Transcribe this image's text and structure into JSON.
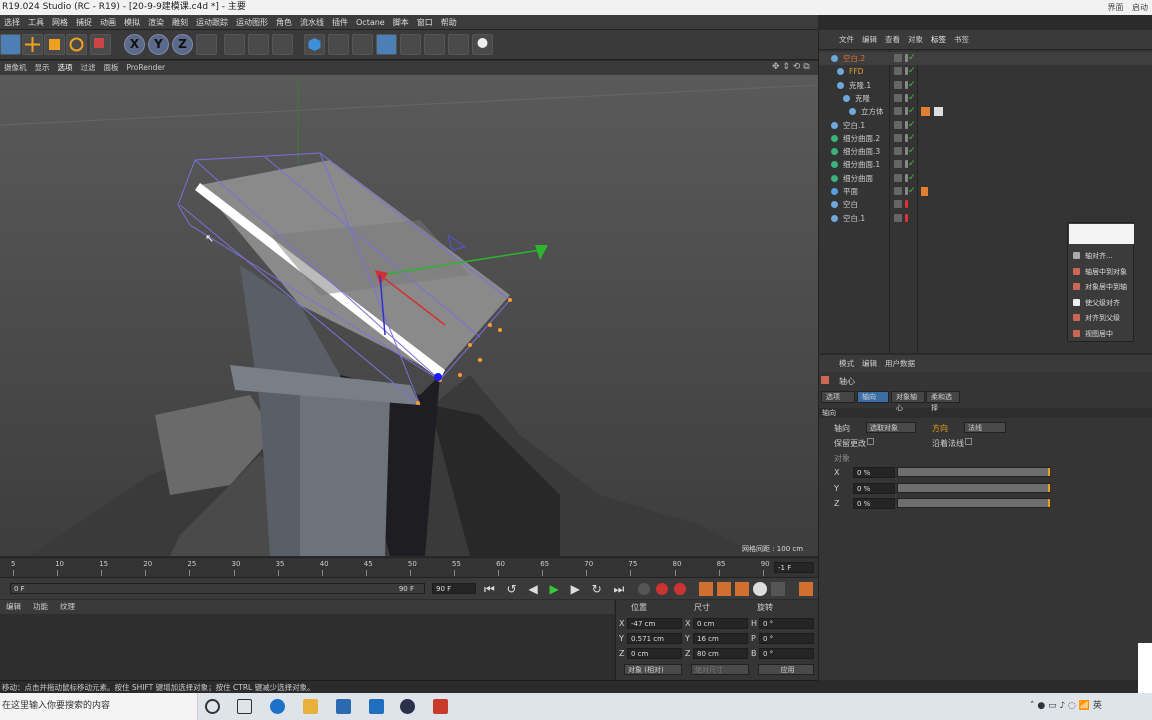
{
  "window": {
    "title": "R19.024 Studio (RC - R19) - [20-9-9建模课.c4d *] - 主要",
    "right_buttons": [
      "界面",
      "启动"
    ]
  },
  "menubar": [
    "选择",
    "工具",
    "网格",
    "捕捉",
    "动画",
    "模拟",
    "渲染",
    "雕刻",
    "运动跟踪",
    "运动图形",
    "角色",
    "流水线",
    "插件",
    "Octane",
    "脚本",
    "窗口",
    "帮助"
  ],
  "viewport": {
    "menu": [
      "摄像机",
      "显示",
      "选项",
      "过滤",
      "面板",
      "ProRender"
    ],
    "grid_spacing": "网格间距 : 100 cm"
  },
  "timeline": {
    "ticks": [
      "5",
      "10",
      "15",
      "20",
      "25",
      "30",
      "35",
      "40",
      "45",
      "50",
      "55",
      "60",
      "65",
      "70",
      "75",
      "80",
      "85",
      "90"
    ],
    "end_frame_field": "-1 F",
    "start_field": "0 F",
    "range_end": "90 F",
    "end_field": "90 F"
  },
  "material_tabs": [
    "编辑",
    "功能",
    "纹理"
  ],
  "coordinates": {
    "headers": [
      "位置",
      "尺寸",
      "旋转"
    ],
    "rows": [
      {
        "axis": "X",
        "pos": "-47 cm",
        "size_axis": "X",
        "size": "0 cm",
        "rot_axis": "H",
        "rot": "0 °"
      },
      {
        "axis": "Y",
        "pos": "0.571 cm",
        "size_axis": "Y",
        "size": "16 cm",
        "rot_axis": "P",
        "rot": "0 °"
      },
      {
        "axis": "Z",
        "pos": "0 cm",
        "size_axis": "Z",
        "size": "80 cm",
        "rot_axis": "B",
        "rot": "0 °"
      }
    ],
    "mode_select": "对象 (相对)",
    "size_select": "绝对尺寸",
    "apply_button": "应用"
  },
  "statusbar": "移动：点击并拖动鼠标移动元素。按住 SHIFT 键增加选择对象；按住 CTRL 键减少选择对象。",
  "object_manager": {
    "tabs": [
      "文件",
      "编辑",
      "查看",
      "对象",
      "标签",
      "书签"
    ],
    "objects": [
      {
        "name": "空白.2",
        "color": "#e07030"
      },
      {
        "name": "FFD",
        "color": "#e0a030"
      },
      {
        "name": "克隆.1",
        "color": "#cccccc"
      },
      {
        "name": "克隆",
        "color": "#cccccc"
      },
      {
        "name": "立方体",
        "color": "#cccccc"
      },
      {
        "name": "空白.1",
        "color": "#cccccc"
      },
      {
        "name": "细分曲面.2",
        "color": "#cccccc"
      },
      {
        "name": "细分曲面.3",
        "color": "#cccccc"
      },
      {
        "name": "细分曲面.1",
        "color": "#cccccc"
      },
      {
        "name": "细分曲面",
        "color": "#cccccc"
      },
      {
        "name": "平面",
        "color": "#cccccc"
      },
      {
        "name": "空白",
        "color": "#cccccc"
      },
      {
        "name": "空白.1",
        "color": "#cccccc"
      }
    ]
  },
  "context_menu": {
    "header": "轴对齐...",
    "items": [
      "轴居中到对象",
      "对象居中到轴",
      "使父级对齐",
      "对齐到父级",
      "视图居中"
    ]
  },
  "attribute_manager": {
    "tabs": [
      "模式",
      "编辑",
      "用户数据"
    ],
    "object_label": "轴心",
    "subtabs": [
      "选项",
      "轴向",
      "对象轴心",
      "柔和选择"
    ],
    "section": "轴向",
    "axis_label": "轴向",
    "axis_value": "选取对象",
    "direction_label": "方向",
    "direction_value": "法线",
    "keep_changes": "保留更改",
    "along_normal": "沿着法线",
    "object_label2": "对象",
    "sliders": [
      {
        "axis": "X",
        "value": "0 %"
      },
      {
        "axis": "Y",
        "value": "0 %"
      },
      {
        "axis": "Z",
        "value": "0 %"
      }
    ]
  },
  "taskbar": {
    "search_placeholder": "在这里输入你要搜索的内容",
    "lang": "英"
  }
}
